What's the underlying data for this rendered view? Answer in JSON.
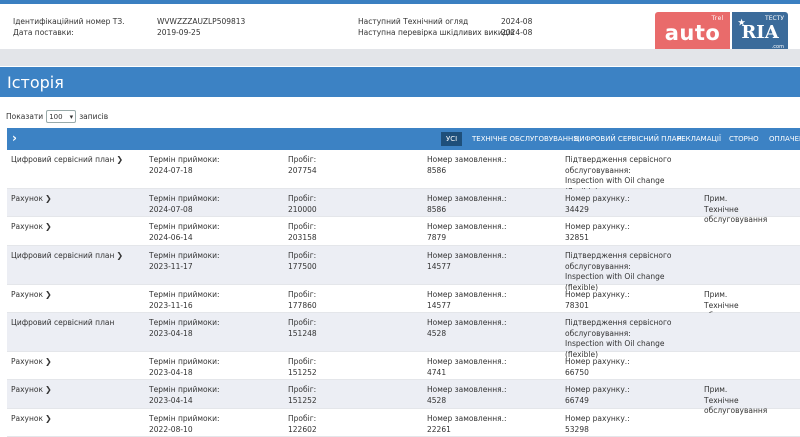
{
  "vehicle": {
    "vin_label": "Ідентифікаційний номер ТЗ.",
    "vin_value": "WVWZZZAUZLP509813",
    "delivery_label": "Дата поставки:",
    "delivery_value": "2019-09-25",
    "next_inspection_label": "Наступний Технічний огляд",
    "next_inspection_value": "2024-08",
    "next_emission_label": "Наступна перевірка шкідливих викидів",
    "next_emission_value": "2024-08"
  },
  "logo": {
    "auto_text": "auto",
    "ria_text": "RIA",
    "auto_small": "Trel",
    "ria_small": "ТЕСТУ",
    "ria_com": ".com"
  },
  "page_title": "Історія",
  "paging": {
    "show_label": "Показати",
    "count": "100",
    "records_label": "записів"
  },
  "filters": [
    "УСІ",
    "ТЕХНІЧНЕ ОБСЛУГОВУВАННЯ",
    "ЦИФРОВИЙ СЕРВІСНИЙ ПЛАН",
    "РЕКЛАМАЦІЇ",
    "СТОРНО",
    "ОПЛАЧЕНО"
  ],
  "labels": {
    "acceptance_date": "Термін приймоки:",
    "mileage": "Пробіг:",
    "order_no": "Номер замовлення.:",
    "invoice_no": "Номер рахунку.:",
    "service_confirm": "Підтвердження сервісного обслуговування:",
    "note": "Прим."
  },
  "records": [
    {
      "type": "Цифровий сервісний план",
      "chevron": true,
      "date": "2024-07-18",
      "mileage": "207754",
      "order": "8586",
      "kind": "plan",
      "confirm": "Inspection with Oil change (flexible)"
    },
    {
      "type": "Рахунок",
      "chevron": true,
      "date": "2024-07-08",
      "mileage": "210000",
      "order": "8586",
      "kind": "invoice",
      "invoice": "34429",
      "note": "Технічне обслуговування"
    },
    {
      "type": "Рахунок",
      "chevron": true,
      "date": "2024-06-14",
      "mileage": "203158",
      "order": "7879",
      "kind": "invoice",
      "invoice": "32851"
    },
    {
      "type": "Цифровий сервісний план",
      "chevron": true,
      "date": "2023-11-17",
      "mileage": "177500",
      "order": "14577",
      "kind": "plan",
      "confirm": "Inspection with Oil change (flexible)"
    },
    {
      "type": "Рахунок",
      "chevron": true,
      "date": "2023-11-16",
      "mileage": "177860",
      "order": "14577",
      "kind": "invoice",
      "invoice": "78301",
      "note": "Технічне обслуговування"
    },
    {
      "type": "Цифровий сервісний план",
      "chevron": false,
      "date": "2023-04-18",
      "mileage": "151248",
      "order": "4528",
      "kind": "plan",
      "confirm": "Inspection with Oil change (flexible)"
    },
    {
      "type": "Рахунок",
      "chevron": true,
      "date": "2023-04-18",
      "mileage": "151252",
      "order": "4741",
      "kind": "invoice",
      "invoice": "66750"
    },
    {
      "type": "Рахунок",
      "chevron": true,
      "date": "2023-04-14",
      "mileage": "151252",
      "order": "4528",
      "kind": "invoice",
      "invoice": "66749",
      "note": "Технічне обслуговування"
    },
    {
      "type": "Рахунок",
      "chevron": true,
      "date": "2022-08-10",
      "mileage": "122602",
      "order": "22261",
      "kind": "invoice",
      "invoice": "53298"
    }
  ]
}
